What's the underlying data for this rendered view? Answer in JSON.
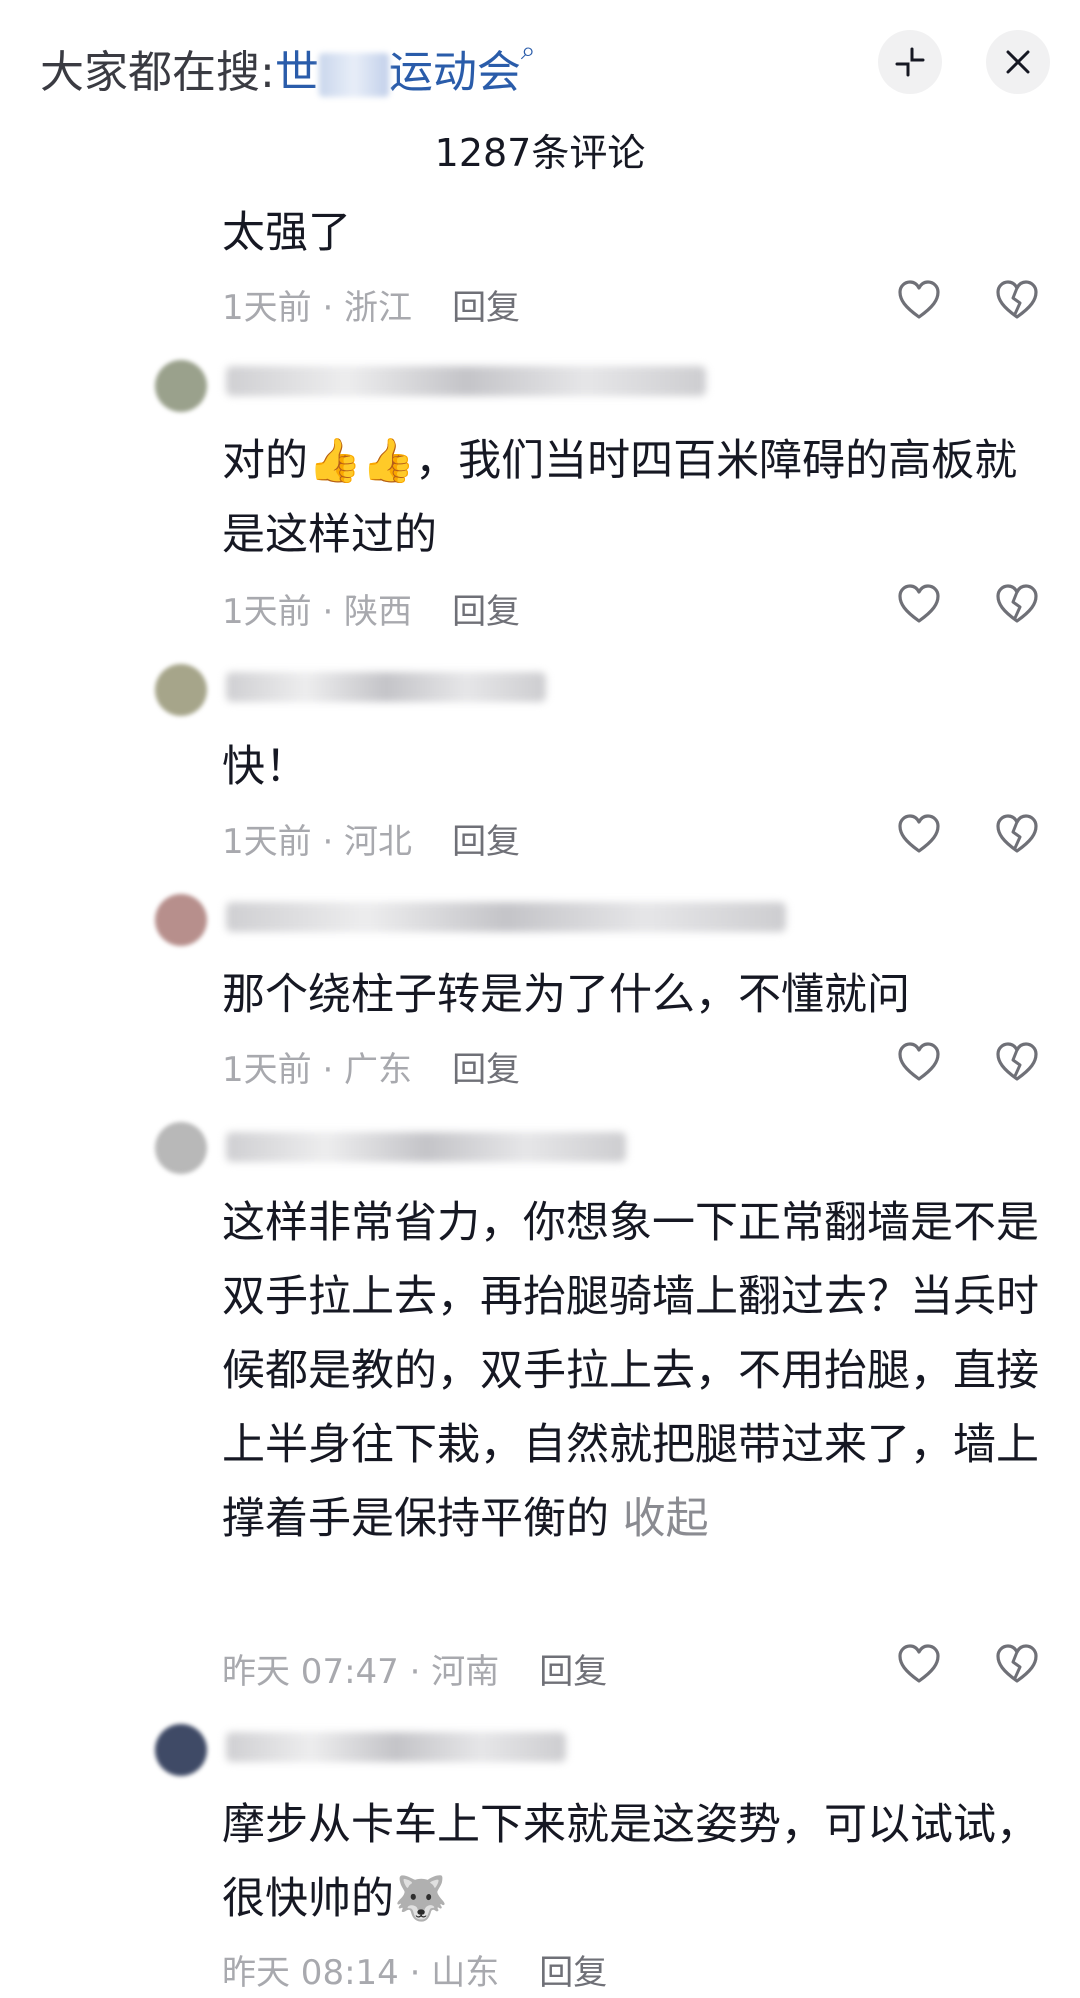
{
  "header": {
    "search_prefix": "大家都在搜:",
    "search_keyword": "运动会",
    "search_keyword_lead": "世",
    "comment_count": "1287条评论"
  },
  "comments": [
    {
      "text": "太强了",
      "time_location": "1天前 · 浙江",
      "reply": "回复"
    },
    {
      "text": "对的👍👍，我们当时四百米障碍的高板就是这样过的",
      "time_location": "1天前 · 陕西",
      "reply": "回复"
    },
    {
      "text": "快！",
      "time_location": "1天前 · 河北",
      "reply": "回复"
    },
    {
      "text": "那个绕柱子转是为了什么，不懂就问",
      "time_location": "1天前 · 广东",
      "reply": "回复"
    },
    {
      "text": "这样非常省力，你想象一下正常翻墙是不是双手拉上去，再抬腿骑墙上翻过去？当兵时候都是教的，双手拉上去，不用抬腿，直接上半身往下栽，自然就把腿带过来了，墙上撑着手是保持平衡的",
      "collapse": " 收起",
      "time_location": "昨天 07:47 · 河南",
      "reply": "回复"
    },
    {
      "text": "摩步从卡车上下来就是这姿势，可以试试，很快帅的🐺",
      "time_location": "昨天 08:14 · 山东",
      "reply": "回复"
    }
  ],
  "icons": {
    "expand": "expand-arrows-icon",
    "close": "close-icon",
    "like": "heart-outline-icon",
    "dislike": "broken-heart-icon"
  }
}
